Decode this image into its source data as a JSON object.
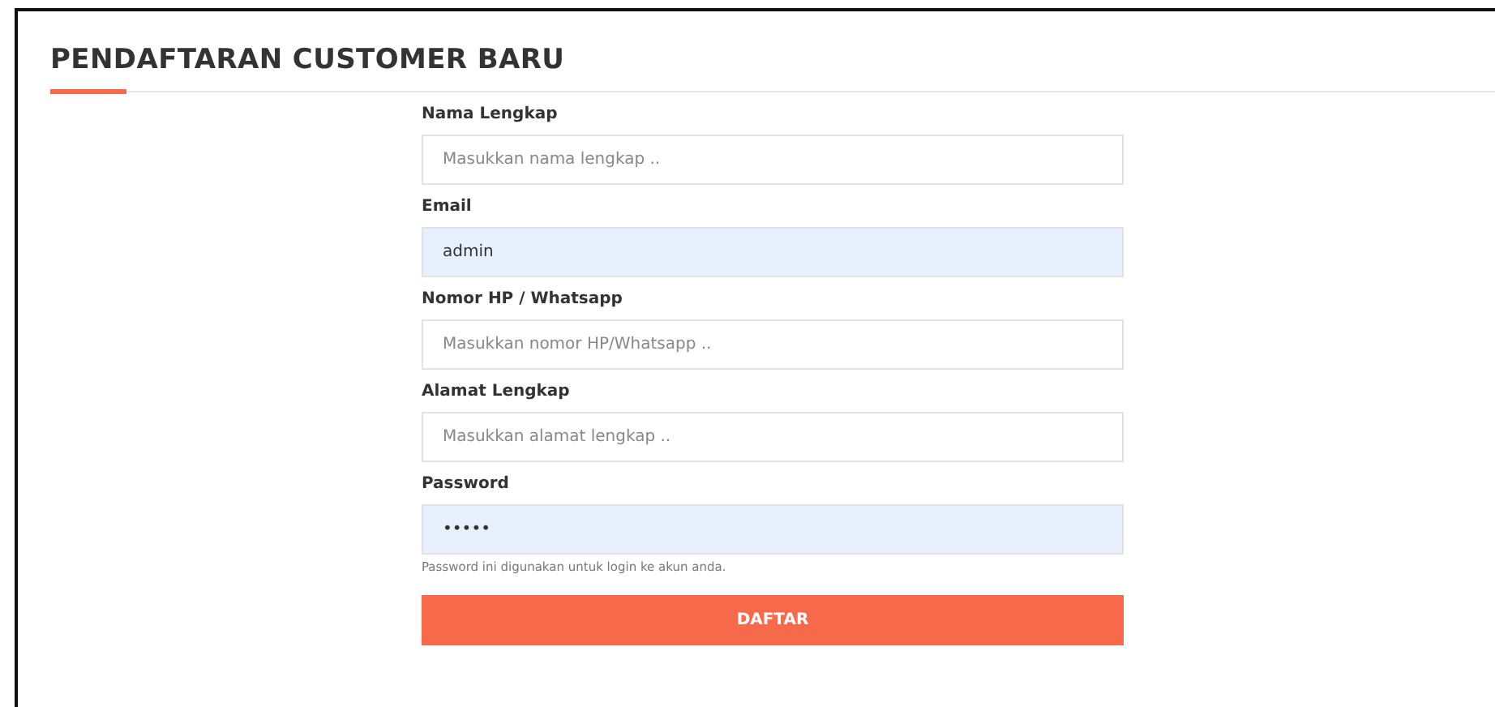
{
  "title": "PENDAFTARAN CUSTOMER BARU",
  "fields": [
    {
      "label": "Nama Lengkap",
      "placeholder": "Masukkan nama lengkap .."
    },
    {
      "label": "Email",
      "value": "admin",
      "autofilled": true
    },
    {
      "label": "Nomor HP / Whatsapp",
      "placeholder": "Masukkan nomor HP/Whatsapp .."
    },
    {
      "label": "Alamat Lengkap",
      "placeholder": "Masukkan alamat lengkap .."
    },
    {
      "label": "Password",
      "value": "•••••",
      "autofilled": true,
      "help": "Password ini digunakan untuk login ke akun anda."
    }
  ],
  "submit": "DAFTAR"
}
